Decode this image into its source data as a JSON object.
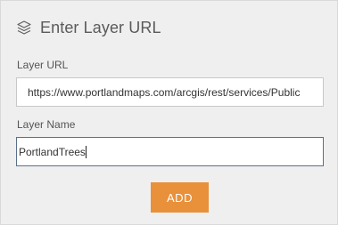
{
  "dialog": {
    "title": "Enter Layer URL",
    "header_icon": "layers-icon"
  },
  "layer_url": {
    "label": "Layer URL",
    "value": "https://www.portlandmaps.com/arcgis/rest/services/Public"
  },
  "layer_name": {
    "label": "Layer Name",
    "value": "PortlandTrees"
  },
  "actions": {
    "add_label": "ADD"
  },
  "colors": {
    "panel_background": "#efefef",
    "add_button": "#e8903a",
    "focused_border": "#5a6f8a"
  }
}
